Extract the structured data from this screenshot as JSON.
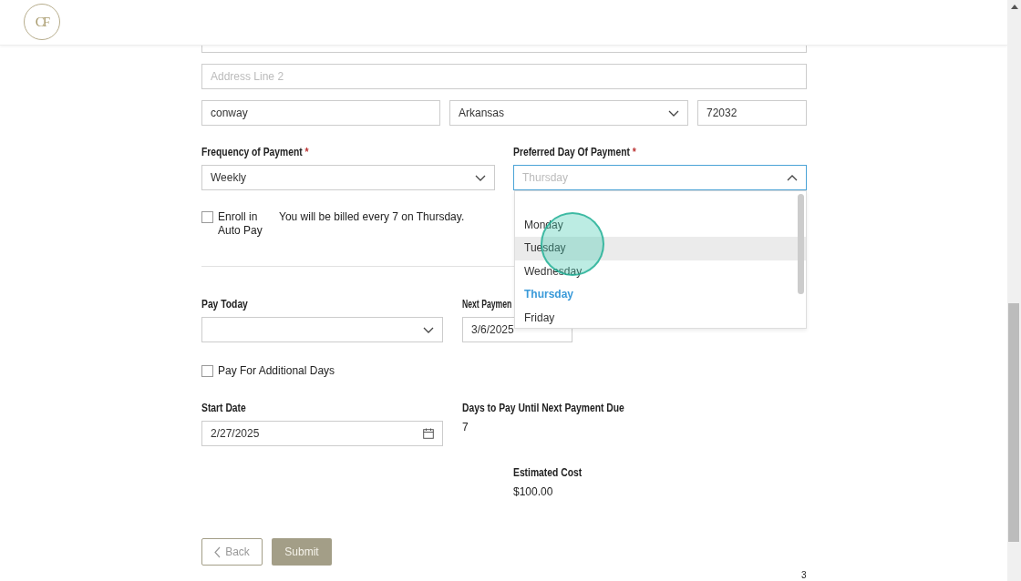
{
  "header": {
    "logo": {
      "text": "CF"
    }
  },
  "address": {
    "line2": {
      "placeholder": "Address Line 2"
    },
    "city": {
      "value": "conway"
    },
    "state": {
      "value": "Arkansas"
    },
    "zip": {
      "value": "72032"
    }
  },
  "frequency": {
    "label": "Frequency of Payment",
    "required_mark": "*",
    "value": "Weekly"
  },
  "preferred_day": {
    "label": "Preferred Day Of Payment",
    "required_mark": "*",
    "placeholder": "Thursday",
    "expanded": true,
    "options": [
      {
        "label": "Monday",
        "selected": false,
        "hovered": false
      },
      {
        "label": "Tuesday",
        "selected": false,
        "hovered": true
      },
      {
        "label": "Wednesday",
        "selected": false,
        "hovered": false
      },
      {
        "label": "Thursday",
        "selected": true,
        "hovered": false
      },
      {
        "label": "Friday",
        "selected": false,
        "hovered": false
      }
    ]
  },
  "auto_pay": {
    "label": "Enroll in Auto Pay",
    "checked": false
  },
  "billing_note": "You will be billed every 7 on Thursday.",
  "pay_today": {
    "label": "Pay Today"
  },
  "next_payment": {
    "label": "Next Paymen",
    "value": "3/6/2025"
  },
  "additional_days": {
    "label": "Pay For Additional Days",
    "checked": false
  },
  "start_date": {
    "label": "Start Date",
    "value": "2/27/2025"
  },
  "days_to_pay": {
    "label": "Days to Pay Until Next Payment Due",
    "value": "7"
  },
  "estimated_cost": {
    "label": "Estimated Cost",
    "value": "$100.00"
  },
  "buttons": [
    {
      "kind": "back",
      "label": "Back"
    },
    {
      "kind": "submit",
      "label": "Submit"
    }
  ],
  "page_number": "3"
}
